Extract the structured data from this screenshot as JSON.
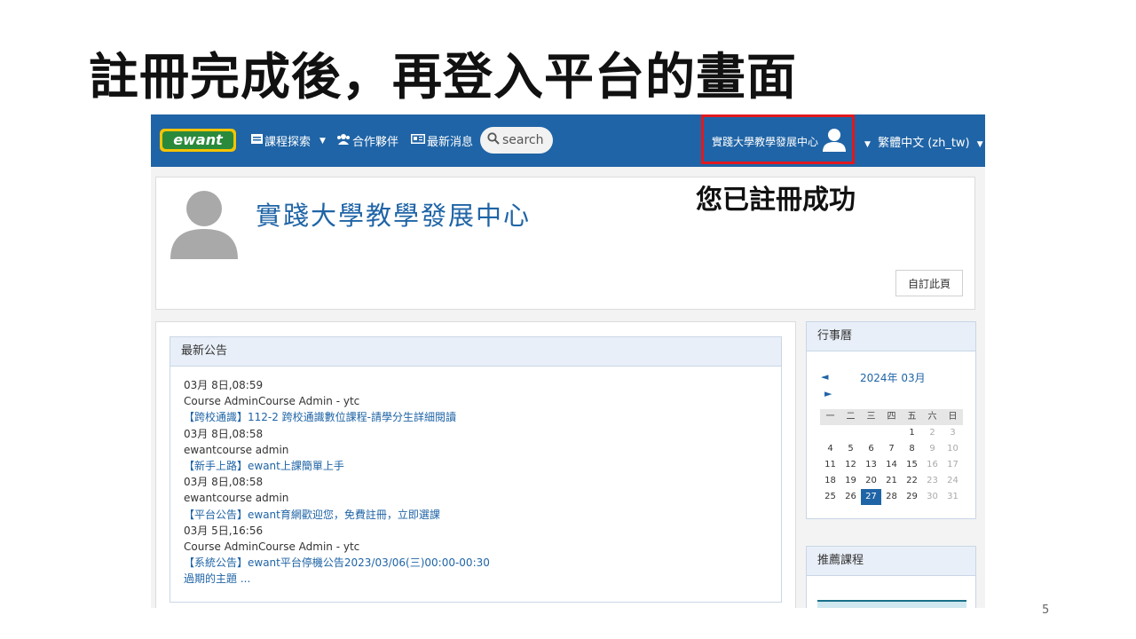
{
  "slide": {
    "title": "註冊完成後，再登入平台的畫面",
    "callout": "您已註冊成功",
    "page_number": "5"
  },
  "navbar": {
    "logo_icon": "ewant-logo",
    "items": [
      {
        "label": "課程探索",
        "icon": "course-icon"
      },
      {
        "label": "合作夥伴",
        "icon": "users-icon"
      },
      {
        "label": "最新消息",
        "icon": "news-icon"
      }
    ],
    "search_placeholder": "search",
    "user_name": "實踐大學教學發展中心",
    "language": "繁體中文 (zh_tw)"
  },
  "profile": {
    "name": "實踐大學教學發展中心",
    "customize_label": "自訂此頁"
  },
  "news": {
    "header": "最新公告",
    "items": [
      {
        "date": "03月 8日,08:59",
        "author": "Course AdminCourse Admin - ytc",
        "title": "【跨校通識】112-2 跨校通識數位課程-請學分生詳細閱讀"
      },
      {
        "date": "03月 8日,08:58",
        "author": "ewantcourse admin",
        "title": "【新手上路】ewant上課簡單上手"
      },
      {
        "date": "03月 8日,08:58",
        "author": "ewantcourse admin",
        "title": "【平台公告】ewant育網歡迎您，免費註冊，立即選課"
      },
      {
        "date": "03月 5日,16:56",
        "author": "Course AdminCourse Admin - ytc",
        "title": "【系統公告】ewant平台停機公告2023/03/06(三)00:00-00:30"
      }
    ],
    "older_label": "過期的主題 ..."
  },
  "calendar": {
    "header": "行事曆",
    "month_label": "2024年 03月",
    "prev": "◄",
    "next": "►",
    "weekdays": [
      "一",
      "二",
      "三",
      "四",
      "五",
      "六",
      "日"
    ],
    "weeks": [
      [
        "",
        "",
        "",
        "",
        "1",
        "2",
        "3"
      ],
      [
        "4",
        "5",
        "6",
        "7",
        "8",
        "9",
        "10"
      ],
      [
        "11",
        "12",
        "13",
        "14",
        "15",
        "16",
        "17"
      ],
      [
        "18",
        "19",
        "20",
        "21",
        "22",
        "23",
        "24"
      ],
      [
        "25",
        "26",
        "27",
        "28",
        "29",
        "30",
        "31"
      ]
    ],
    "today": "27",
    "today_color": "#1f64a6"
  },
  "recommended": {
    "header": "推薦課程"
  },
  "colors": {
    "navbar": "#1f64a6",
    "highlight_box": "#e0191e",
    "link": "#1f64a6"
  }
}
